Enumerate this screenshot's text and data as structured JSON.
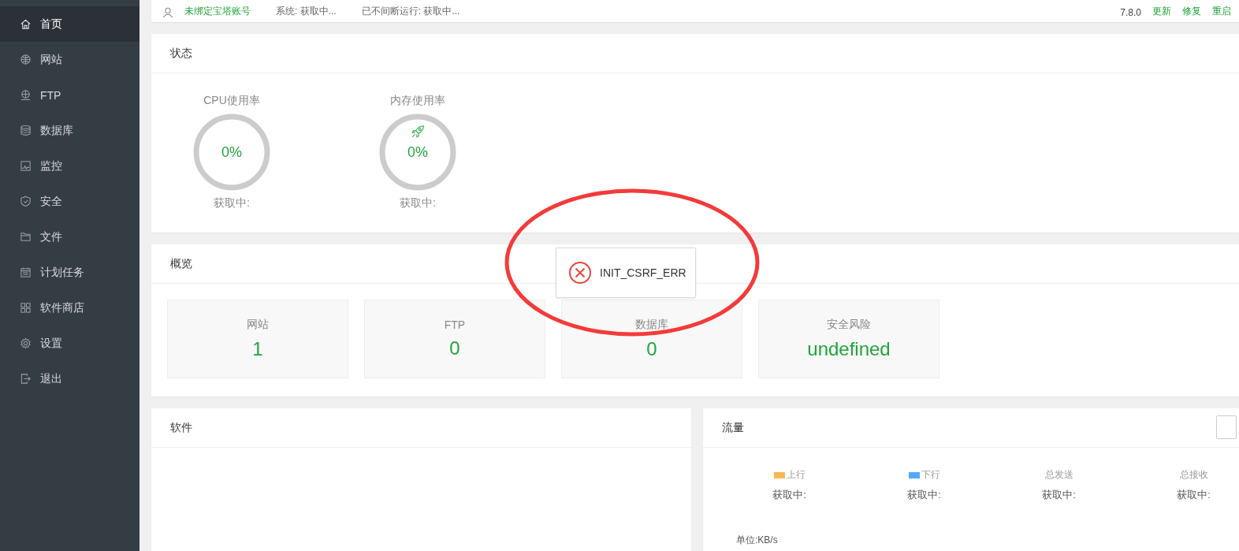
{
  "sidebar": {
    "items": [
      {
        "label": "首页",
        "selected": true
      },
      {
        "label": "网站",
        "selected": false
      },
      {
        "label": "FTP",
        "selected": false
      },
      {
        "label": "数据库",
        "selected": false
      },
      {
        "label": "监控",
        "selected": false
      },
      {
        "label": "安全",
        "selected": false
      },
      {
        "label": "文件",
        "selected": false
      },
      {
        "label": "计划任务",
        "selected": false
      },
      {
        "label": "软件商店",
        "selected": false
      },
      {
        "label": "设置",
        "selected": false
      },
      {
        "label": "退出",
        "selected": false
      }
    ]
  },
  "top_bar": {
    "account": "未绑定宝塔账号",
    "system": "系统: 获取中...",
    "uptime": "已不间断运行: 获取中...",
    "version": "7.8.0",
    "actions": [
      "更新",
      "修复",
      "重启"
    ]
  },
  "status": {
    "title": "状态",
    "gauges": [
      {
        "label": "CPU使用率",
        "value": "0%",
        "caption": "获取中:"
      },
      {
        "label": "内存使用率",
        "value": "0%",
        "caption": "获取中:"
      }
    ]
  },
  "overview": {
    "title": "概览",
    "cards": [
      {
        "label": "网站",
        "value": "1"
      },
      {
        "label": "FTP",
        "value": "0"
      },
      {
        "label": "数据库",
        "value": "0"
      },
      {
        "label": "安全风险",
        "value": "undefined"
      }
    ]
  },
  "software": {
    "title": "软件"
  },
  "traffic": {
    "title": "流量",
    "stats": [
      {
        "label": "上行",
        "color": "#f7b851",
        "value": "获取中:"
      },
      {
        "label": "下行",
        "color": "#52a9ff",
        "value": "获取中:"
      },
      {
        "label": "总发送",
        "value": "获取中:"
      },
      {
        "label": "总接收",
        "value": "获取中:"
      }
    ],
    "unit": "单位:KB/s"
  },
  "toast": {
    "message": "INIT_CSRF_ERR"
  }
}
